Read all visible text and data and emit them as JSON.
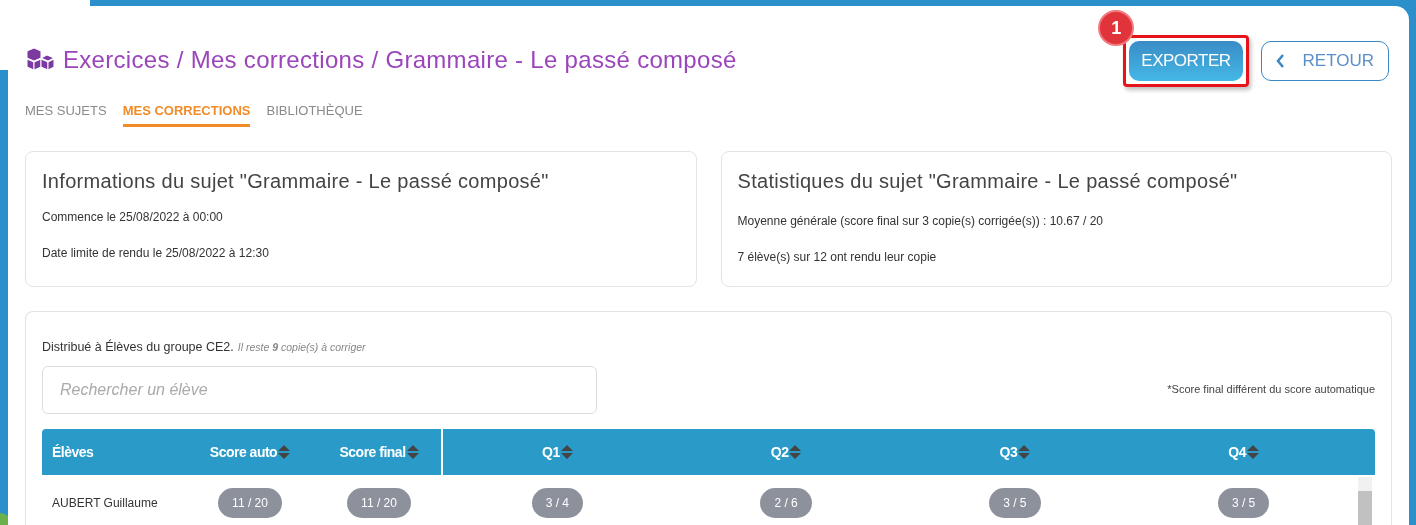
{
  "breadcrumb": "Exercices / Mes corrections / Grammaire - Le passé composé",
  "actions": [
    {
      "kind": "primary",
      "label": "EXPORTER",
      "highlighted": true,
      "callout": "1"
    },
    {
      "kind": "back",
      "label": "RETOUR",
      "highlighted": false
    }
  ],
  "tabs": [
    {
      "label": "MES SUJETS",
      "selected": false
    },
    {
      "label": "MES CORRECTIONS",
      "selected": true
    },
    {
      "label": "BIBLIOTHÈQUE",
      "selected": false
    }
  ],
  "info_card": {
    "title": "Informations du sujet \"Grammaire - Le passé composé\"",
    "lines": [
      "Commence le 25/08/2022 à 00:00",
      "Date limite de rendu le  25/08/2022 à 12:30"
    ]
  },
  "stats_card": {
    "title": "Statistiques du sujet \"Grammaire - Le passé composé\"",
    "lines": [
      "Moyenne générale (score final sur 3 copie(s) corrigée(s)) : 10.67 / 20",
      "7 élève(s) sur 12 ont rendu leur copie"
    ]
  },
  "distribution": {
    "text": "Distribué à Élèves du groupe CE2.",
    "remaining": "Il reste **9** copie(s) à corriger"
  },
  "search": {
    "placeholder": "Rechercher un élève"
  },
  "legend": "*Score final différent du score automatique",
  "table": {
    "columns": [
      {
        "label": "Élèves",
        "sortable": false
      },
      {
        "label": "Score auto",
        "sortable": true
      },
      {
        "label": "Score final",
        "sortable": true
      },
      {
        "label": "Q1",
        "sortable": true
      },
      {
        "label": "Q2",
        "sortable": true
      },
      {
        "label": "Q3",
        "sortable": true
      },
      {
        "label": "Q4",
        "sortable": true
      }
    ],
    "rows": [
      {
        "student": "AUBERT Guillaume",
        "scores": [
          "11 / 20",
          "11 / 20",
          "3 / 4",
          "2 / 6",
          "3 / 5",
          "3 / 5"
        ]
      }
    ]
  }
}
